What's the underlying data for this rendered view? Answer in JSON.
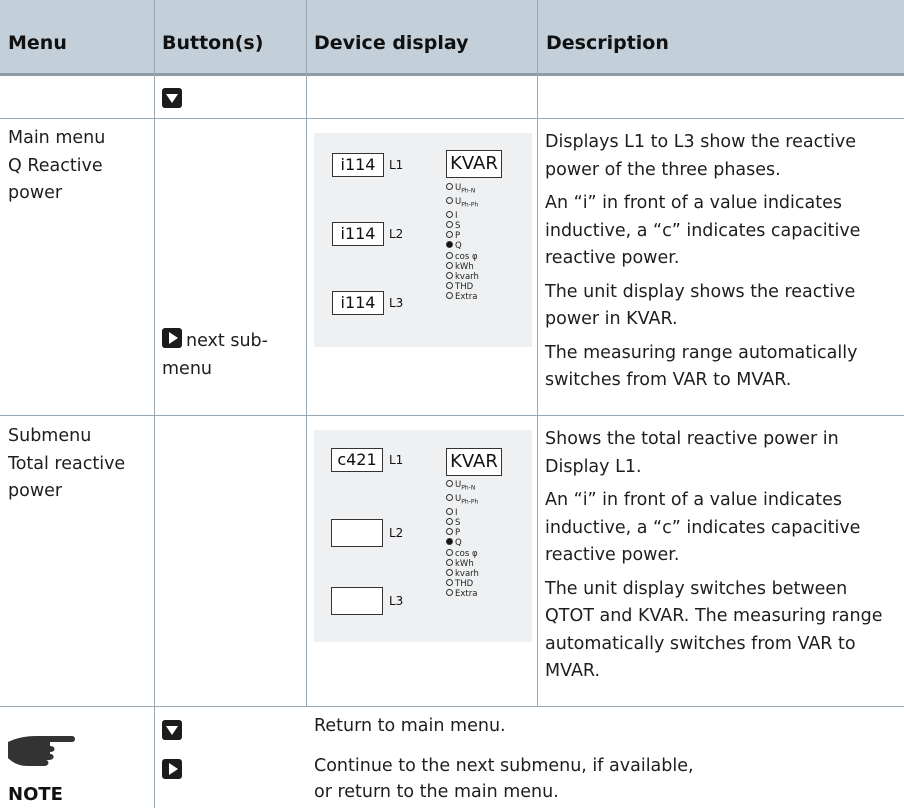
{
  "headers": {
    "menu": "Menu",
    "buttons": "Button(s)",
    "display": "Device display",
    "description": "Description"
  },
  "row_main": {
    "menu_line1": "Main menu",
    "menu_line2": "Q Reactive",
    "menu_line3": "power",
    "button_label_a": "next sub-",
    "button_label_b": "menu",
    "display": {
      "l1_value": "i114",
      "l2_value": "i114",
      "l3_value": "i114",
      "l1": "L1",
      "l2": "L2",
      "l3": "L3",
      "unit": "KVAR",
      "active_led": "Q"
    },
    "desc": [
      "Displays L1 to L3 show the reactive power of the three phases.",
      "An “i” in front of a value indicates inductive, a “c” indicates capacitive reactive power.",
      "The unit display shows the reactive power in KVAR.",
      "The measuring range automatically switches from VAR to MVAR."
    ]
  },
  "row_sub": {
    "menu_line1": "Submenu",
    "menu_line2": "Total reactive",
    "menu_line3": "power",
    "display": {
      "l1_value": "c421",
      "l2_value": "",
      "l3_value": "",
      "l1": "L1",
      "l2": "L2",
      "l3": "L3",
      "unit": "KVAR",
      "active_led": "Q"
    },
    "desc": [
      "Shows the total reactive power in Display L1.",
      "An “i” in front of a value indicates inductive, a “c” indicates capacitive reactive power.",
      "The unit display switches between QTOT and KVAR. The measuring range automatically switches from VAR to MVAR."
    ]
  },
  "leds": [
    "U",
    "U",
    "I",
    "S",
    "P",
    "Q",
    "cos φ",
    "kWh",
    "kvarh",
    "THD",
    "Extra"
  ],
  "led_subs": {
    "0": "Ph-N",
    "1": "Ph-Ph"
  },
  "note": {
    "label": "NOTE",
    "return_text": "Return to main menu.",
    "continue_line1": "Continue to the next submenu, if available,",
    "continue_line2": "or return to the main menu."
  },
  "colors": {
    "header_bg": "#c4d0d9",
    "rule": "#9aa8b4",
    "panel_bg": "#eef0f2"
  }
}
